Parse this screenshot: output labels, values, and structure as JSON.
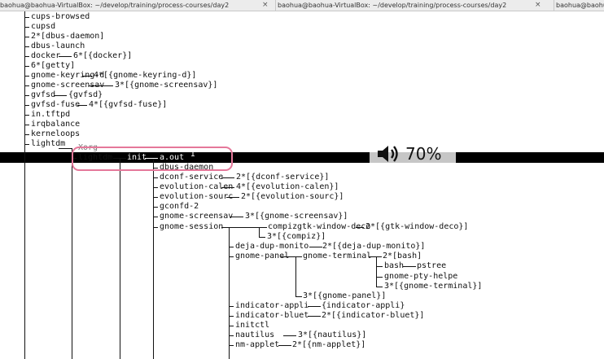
{
  "tabs": [
    {
      "label": "baohua@baohua-VirtualBox: ~/develop/training/process-courses/day2"
    },
    {
      "label": "baohua@baohua-VirtualBox: ~/develop/training/process-courses/day2"
    },
    {
      "label": "baohua@baohua"
    }
  ],
  "tree": [
    "cups-browsed",
    "cupsd",
    "2*[dbus-daemon]",
    "dbus-launch",
    "docker",
    "6*[getty]",
    "gnome-keyring-d",
    "gnome-screensav",
    "gvfsd",
    "gvfsd-fuse",
    "in.tftpd",
    "irqbalance",
    "kerneloops",
    "lightdm",
    "Xorg",
    "lightdm",
    "init",
    "a.out",
    "dbus-daemon",
    "dconf-service",
    "evolution-calen",
    "evolution-sourc",
    "gconfd-2",
    "gnome-screensav",
    "gnome-session",
    "compiz",
    "gtk-window-deco",
    "3*[{compiz}]",
    "deja-dup-monito",
    "gnome-panel",
    "gnome-terminal",
    "2*[bash]",
    "bash",
    "pstree",
    "gnome-pty-helpe",
    "3*[{gnome-terminal}]",
    "3*[{gnome-panel}]",
    "indicator-appli",
    "indicator-bluet",
    "initctl",
    "nautilus",
    "nm-applet",
    "6*[{docker}]",
    "4*[{gnome-keyring-d}]",
    "3*[{gnome-screensav}]",
    "{gvfsd}",
    "4*[{gvfsd-fuse}]",
    "2*[{dconf-service}]",
    "4*[{evolution-calen}]",
    "2*[{evolution-sourc}]",
    "3*[{gnome-screensav}]",
    "2*[{gtk-window-deco}]",
    "2*[{deja-dup-monito}]",
    "{indicator-appli}",
    "2*[{indicator-bluet}]",
    "3*[{nautilus}]",
    "2*[{nm-applet}]"
  ],
  "osd": {
    "icon": "speaker-icon",
    "volume": "70%"
  },
  "colors": {
    "highlight_box": "#e5789a",
    "selection_bar": "#000000",
    "osd_bg": "#c6c6c6"
  }
}
